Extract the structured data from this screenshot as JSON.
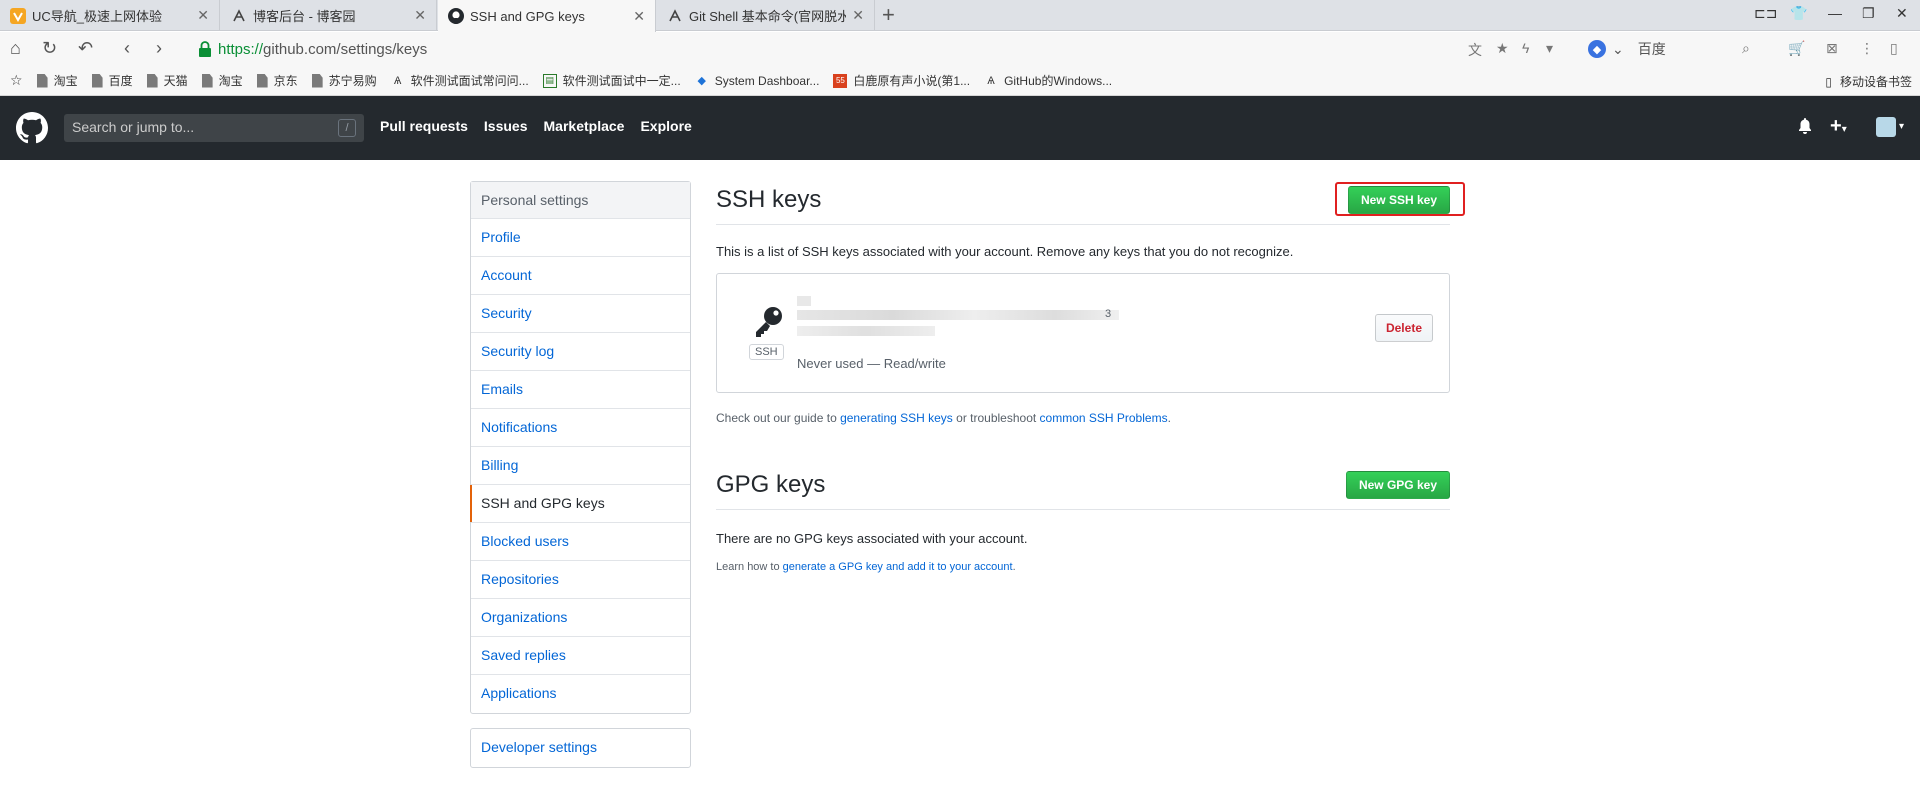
{
  "browser": {
    "tabs": [
      {
        "title": "UC导航_极速上网体验",
        "active": false
      },
      {
        "title": "博客后台 - 博客园",
        "active": false
      },
      {
        "title": "SSH and GPG keys",
        "active": true
      },
      {
        "title": "Git Shell 基本命令(官网脱水版",
        "active": false
      }
    ],
    "url_scheme": "https://",
    "url_rest": "github.com/settings/keys",
    "search_engine": "百度",
    "bookmarks": [
      "淘宝",
      "百度",
      "天猫",
      "淘宝",
      "京东",
      "苏宁易购",
      "软件测试面试常问问...",
      "软件测试面试中一定...",
      "System Dashboar...",
      "白鹿原有声小说(第1...",
      "GitHub的Windows..."
    ],
    "mobile_bookmarks": "移动设备书签"
  },
  "github": {
    "search_placeholder": "Search or jump to...",
    "search_shortcut": "/",
    "nav": [
      "Pull requests",
      "Issues",
      "Marketplace",
      "Explore"
    ]
  },
  "settings": {
    "heading": "Personal settings",
    "items": [
      "Profile",
      "Account",
      "Security",
      "Security log",
      "Emails",
      "Notifications",
      "Billing",
      "SSH and GPG keys",
      "Blocked users",
      "Repositories",
      "Organizations",
      "Saved replies",
      "Applications"
    ],
    "developer": "Developer settings"
  },
  "ssh": {
    "title": "SSH keys",
    "new_button": "New SSH key",
    "description": "This is a list of SSH keys associated with your account. Remove any keys that you do not recognize.",
    "key_badge": "SSH",
    "key_suffix": "3",
    "key_usage": "Never used — Read/write",
    "delete_button": "Delete",
    "guide_prefix": "Check out our guide to ",
    "guide_link1": "generating SSH keys",
    "guide_mid": " or troubleshoot ",
    "guide_link2": "common SSH Problems",
    "guide_end": "."
  },
  "gpg": {
    "title": "GPG keys",
    "new_button": "New GPG key",
    "empty": "There are no GPG keys associated with your account.",
    "learn_prefix": "Learn how to ",
    "learn_link": "generate a GPG key and add it to your account",
    "learn_end": "."
  },
  "colors": {
    "header_bg": "#24292e",
    "link": "#0366d6",
    "primary_green": "#28a745",
    "selected_accent": "#e36209",
    "danger": "#cb2431",
    "highlight_red": "#e02020"
  }
}
